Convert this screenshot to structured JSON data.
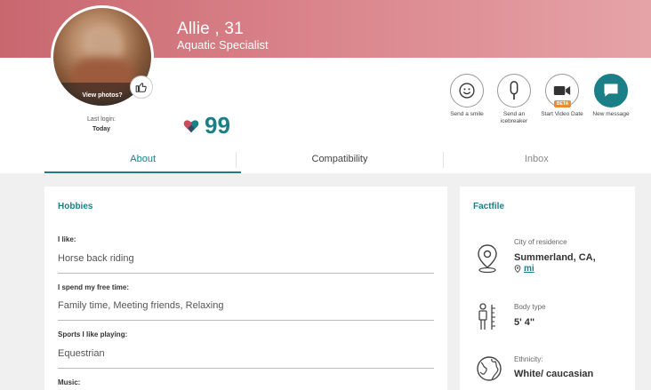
{
  "profile": {
    "name": "Allie , 31",
    "job": "Aquatic Specialist",
    "view_photos": "View photos?",
    "last_login_label": "Last login:",
    "last_login_value": "Today",
    "match_score": "99"
  },
  "actions": [
    {
      "label": "Send a smile",
      "icon": "smile-icon"
    },
    {
      "label": "Send an icebreaker",
      "icon": "icebreaker-icon"
    },
    {
      "label": "Start Video Date",
      "icon": "video-camera-icon",
      "badge": "BETA"
    },
    {
      "label": "New message",
      "icon": "message-icon"
    }
  ],
  "tabs": [
    "About",
    "Compatibility",
    "Inbox"
  ],
  "hobbies": {
    "title": "Hobbies",
    "items": [
      {
        "question": "I like:",
        "answer": "Horse back riding"
      },
      {
        "question": "I spend my free time:",
        "answer": "Family time, Meeting friends, Relaxing"
      },
      {
        "question": "Sports I like playing:",
        "answer": "Equestrian"
      },
      {
        "question": "Music:",
        "answer": ""
      }
    ]
  },
  "factfile": {
    "title": "Factfile",
    "residence_label": "City of residence",
    "residence_value": "Summerland, CA,",
    "distance_unit": "mi",
    "body_type_label": "Body type",
    "body_type_value": "5' 4\"",
    "ethnicity_label": "Ethnicity:",
    "ethnicity_value": "White/ caucasian"
  },
  "colors": {
    "accent": "#1b7f88",
    "header": "#d98289",
    "beta": "#f08a2b"
  }
}
